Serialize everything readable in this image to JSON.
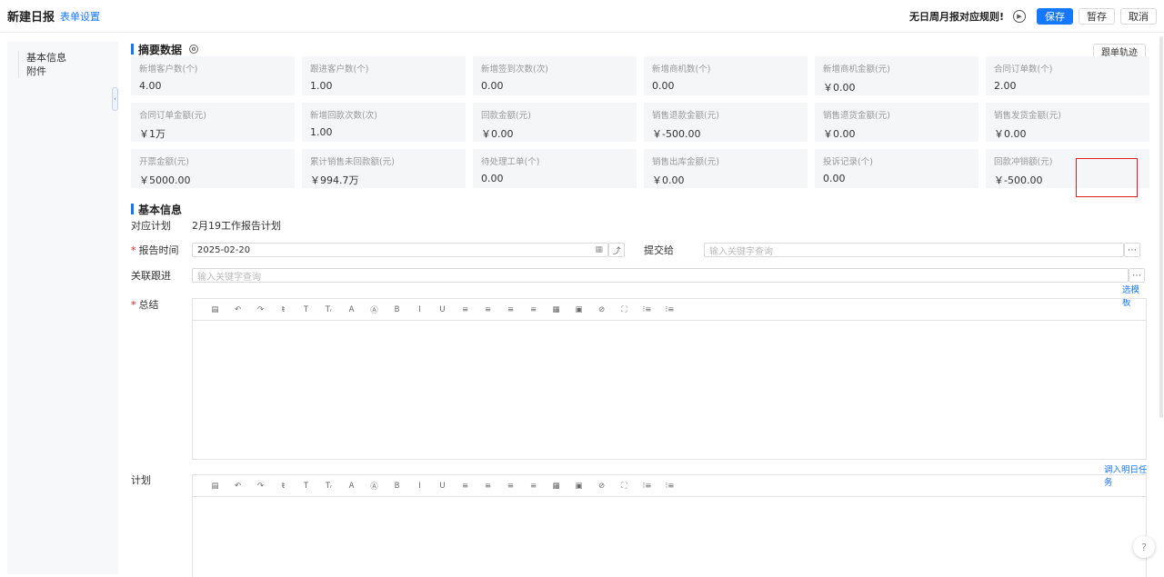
{
  "header": {
    "title": "新建日报",
    "settings_link": "表单设置",
    "rule_text": "无日周月报对应规则!",
    "save": "保存",
    "temp_save": "暂存",
    "cancel": "取消"
  },
  "leftnav": {
    "items": [
      "基本信息",
      "附件"
    ]
  },
  "summary": {
    "title": "摘要数据",
    "track_button": "跟单轨迹",
    "cards": [
      {
        "label": "新增客户数(个)",
        "value": "4.00"
      },
      {
        "label": "跟进客户数(个)",
        "value": "1.00"
      },
      {
        "label": "新增签到次数(次)",
        "value": "0.00"
      },
      {
        "label": "新增商机数(个)",
        "value": "0.00"
      },
      {
        "label": "新增商机金额(元)",
        "value": "￥0.00"
      },
      {
        "label": "合同订单数(个)",
        "value": "2.00"
      },
      {
        "label": "合同订单金额(元)",
        "value": "￥1万"
      },
      {
        "label": "新增回款次数(次)",
        "value": "1.00"
      },
      {
        "label": "回款金额(元)",
        "value": "￥0.00"
      },
      {
        "label": "销售退款金额(元)",
        "value": "￥-500.00"
      },
      {
        "label": "销售退货金额(元)",
        "value": "￥0.00"
      },
      {
        "label": "销售发货金额(元)",
        "value": "￥0.00"
      },
      {
        "label": "开票金额(元)",
        "value": "￥5000.00"
      },
      {
        "label": "累计销售未回款额(元)",
        "value": "￥994.7万"
      },
      {
        "label": "待处理工单(个)",
        "value": "0.00"
      },
      {
        "label": "销售出库金额(元)",
        "value": "￥0.00"
      },
      {
        "label": "投诉记录(个)",
        "value": "0.00"
      },
      {
        "label": "回款冲销额(元)",
        "value": "￥-500.00"
      }
    ]
  },
  "basic": {
    "title": "基本信息",
    "plan_label": "对应计划",
    "plan_value": "2月19工作报告计划",
    "report_time_label": "报告时间",
    "report_time_value": "2025-02-20",
    "submit_to_label": "提交给",
    "submit_to_placeholder": "输入关键字查询",
    "related_label": "关联跟进",
    "related_placeholder": "输入关键字查询",
    "template_link": "选模板",
    "summary_label": "总结",
    "import_link": "调入明日任务",
    "plan_editor_label": "计划"
  },
  "toolbar_icons": [
    "▤",
    "↶",
    "↷",
    "ŧ",
    "T",
    "Tᵣ",
    "A",
    "Ⓐ",
    "B",
    "I",
    "U",
    "≡",
    "≡",
    "≡",
    "≡",
    "▦",
    "▣",
    "⊘",
    "⛶",
    "⁝≡",
    "⁝≡"
  ]
}
